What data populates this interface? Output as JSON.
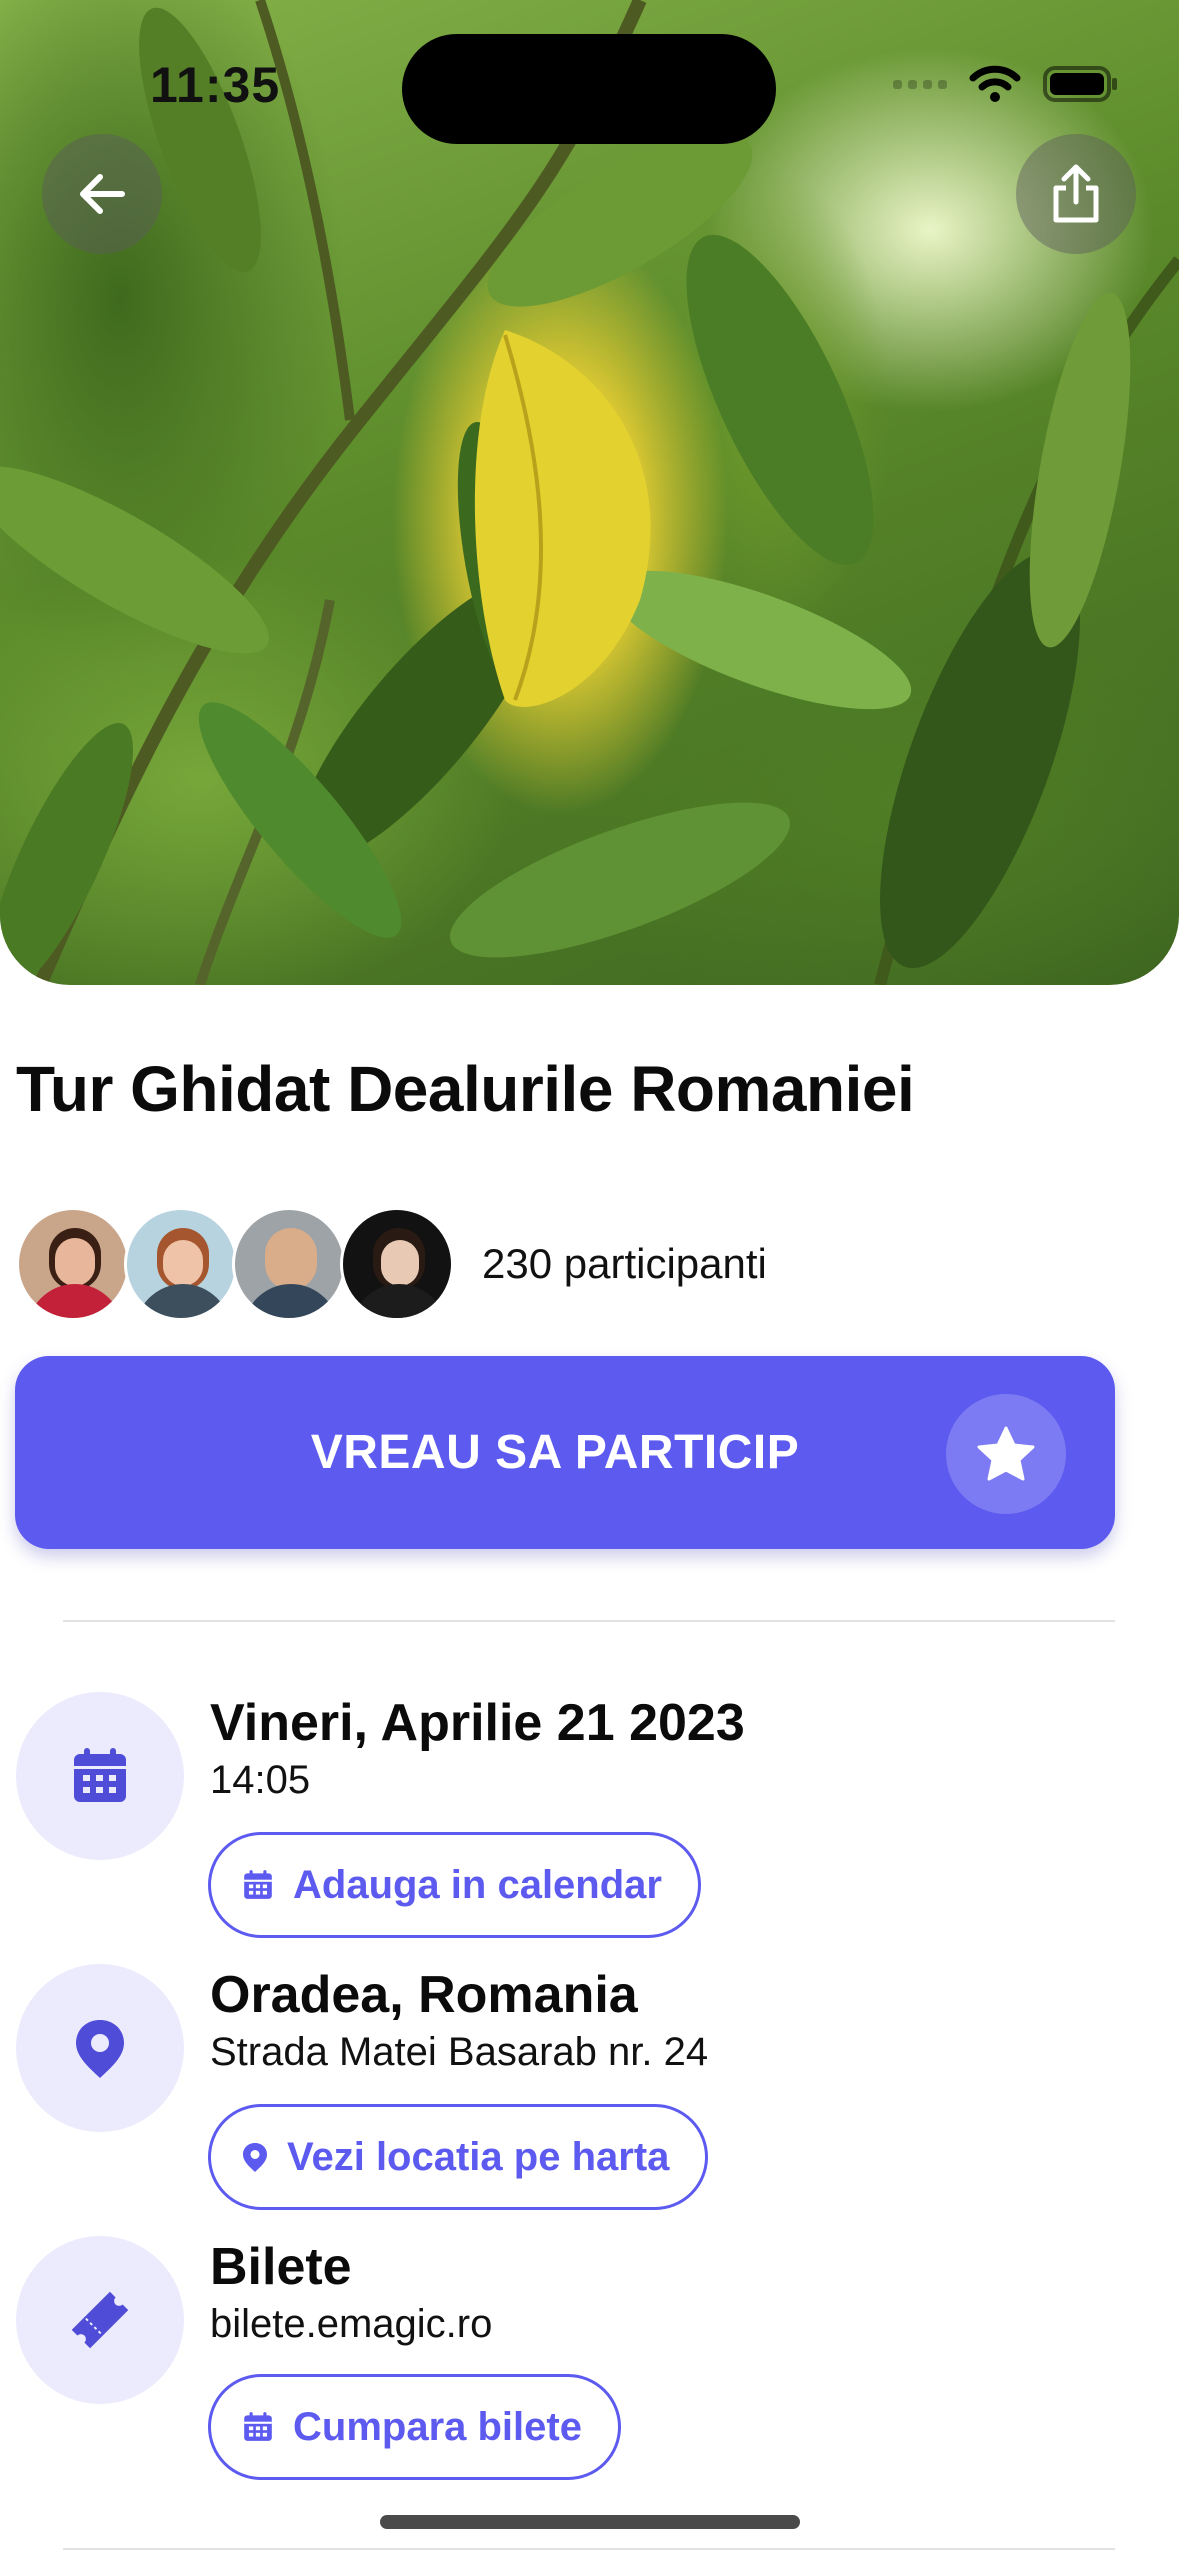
{
  "status_bar": {
    "time": "11:35"
  },
  "event": {
    "title": "Tur Ghidat Dealurile Romaniei",
    "participants_text": "230 participanti"
  },
  "cta": {
    "label": "VREAU SA PARTICIP"
  },
  "details": {
    "date": {
      "title": "Vineri, Aprilie 21 2023",
      "subtitle": "14:05",
      "action": "Adauga in calendar"
    },
    "location": {
      "title": "Oradea, Romania",
      "subtitle": "Strada Matei Basarab nr. 24",
      "action": "Vezi locatia pe harta"
    },
    "tickets": {
      "title": "Bilete",
      "subtitle": "bilete.emagic.ro",
      "action": "Cumpara bilete"
    }
  },
  "colors": {
    "accent": "#5d5af0",
    "icon_bg": "#ecebfd"
  },
  "icons": [
    "back-arrow-icon",
    "share-icon",
    "star-icon",
    "calendar-icon",
    "location-pin-icon",
    "ticket-icon",
    "wifi-icon",
    "battery-icon"
  ]
}
